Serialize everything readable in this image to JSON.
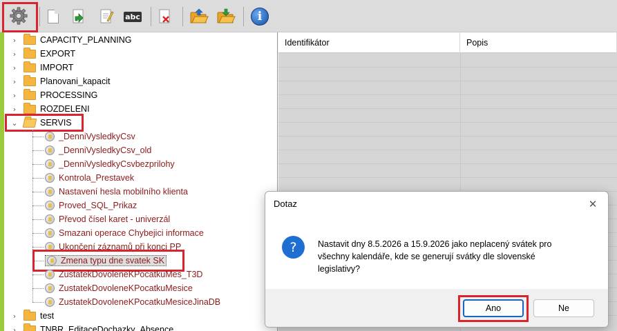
{
  "toolbar": {
    "buttons": [
      {
        "name": "settings",
        "icon": "gear-icon"
      },
      {
        "name": "new",
        "icon": "new-document-icon"
      },
      {
        "name": "export",
        "icon": "export-document-icon"
      },
      {
        "name": "edit",
        "icon": "edit-document-icon"
      },
      {
        "name": "rename",
        "icon": "rename-abc-icon",
        "text": "abc"
      },
      {
        "name": "delete",
        "icon": "delete-document-icon"
      },
      {
        "name": "open-folder",
        "icon": "open-folder-icon"
      },
      {
        "name": "save-folder",
        "icon": "save-folder-icon"
      },
      {
        "name": "info",
        "icon": "info-icon",
        "text": "i"
      }
    ]
  },
  "tree": {
    "folders_top": [
      {
        "label": "CAPACITY_PLANNING",
        "expanded": false
      },
      {
        "label": "EXPORT",
        "expanded": false
      },
      {
        "label": "IMPORT",
        "expanded": false
      },
      {
        "label": "Planovani_kapacit",
        "expanded": false
      },
      {
        "label": "PROCESSING",
        "expanded": false
      },
      {
        "label": "ROZDELENI",
        "expanded": false
      },
      {
        "label": "SERVIS",
        "expanded": true
      }
    ],
    "servis_children": [
      "_DenniVysledkyCsv",
      "_DenniVysledkyCsv_old",
      "_DenniVysledkyCsvbezprilohy",
      "Kontrola_Prestavek",
      "Nastavení hesla mobilního klienta",
      "Proved_SQL_Prikaz",
      "Převod čísel karet - univerzál",
      "Smazani operace Chybejici informace",
      "Ukončení záznamů při konci PP",
      "Zmena typu dne svatek SK",
      "ZustatekDovoleneKPocatkuMes_T3D",
      "ZustatekDovoleneKPocatkuMesice",
      "ZustatekDovoleneKPocatkuMesiceJinaDB"
    ],
    "folders_bottom": [
      {
        "label": "test",
        "expanded": false
      },
      {
        "label": "TNBR_EditaceDochazky_Absence",
        "expanded": false
      }
    ],
    "selected": "Zmena typu dne svatek SK"
  },
  "grid": {
    "columns": [
      "Identifikátor",
      "Popis"
    ]
  },
  "dialog": {
    "title": "Dotaz",
    "close_glyph": "✕",
    "icon": "question-icon",
    "icon_glyph": "?",
    "message_lines": [
      "Nastavit dny 8.5.2026 a 15.9.2026 jako neplacený svátek pro",
      "všechny kalendáře, kde se generují svátky dle slovenské",
      "legislativy?"
    ],
    "buttons": {
      "yes": "Ano",
      "no": "Ne"
    }
  },
  "colors": {
    "highlight": "#d9232d",
    "leaf_text": "#8b1a1a",
    "tree_accent": "#9bcb3b",
    "primary_button_border": "#1664c7"
  }
}
